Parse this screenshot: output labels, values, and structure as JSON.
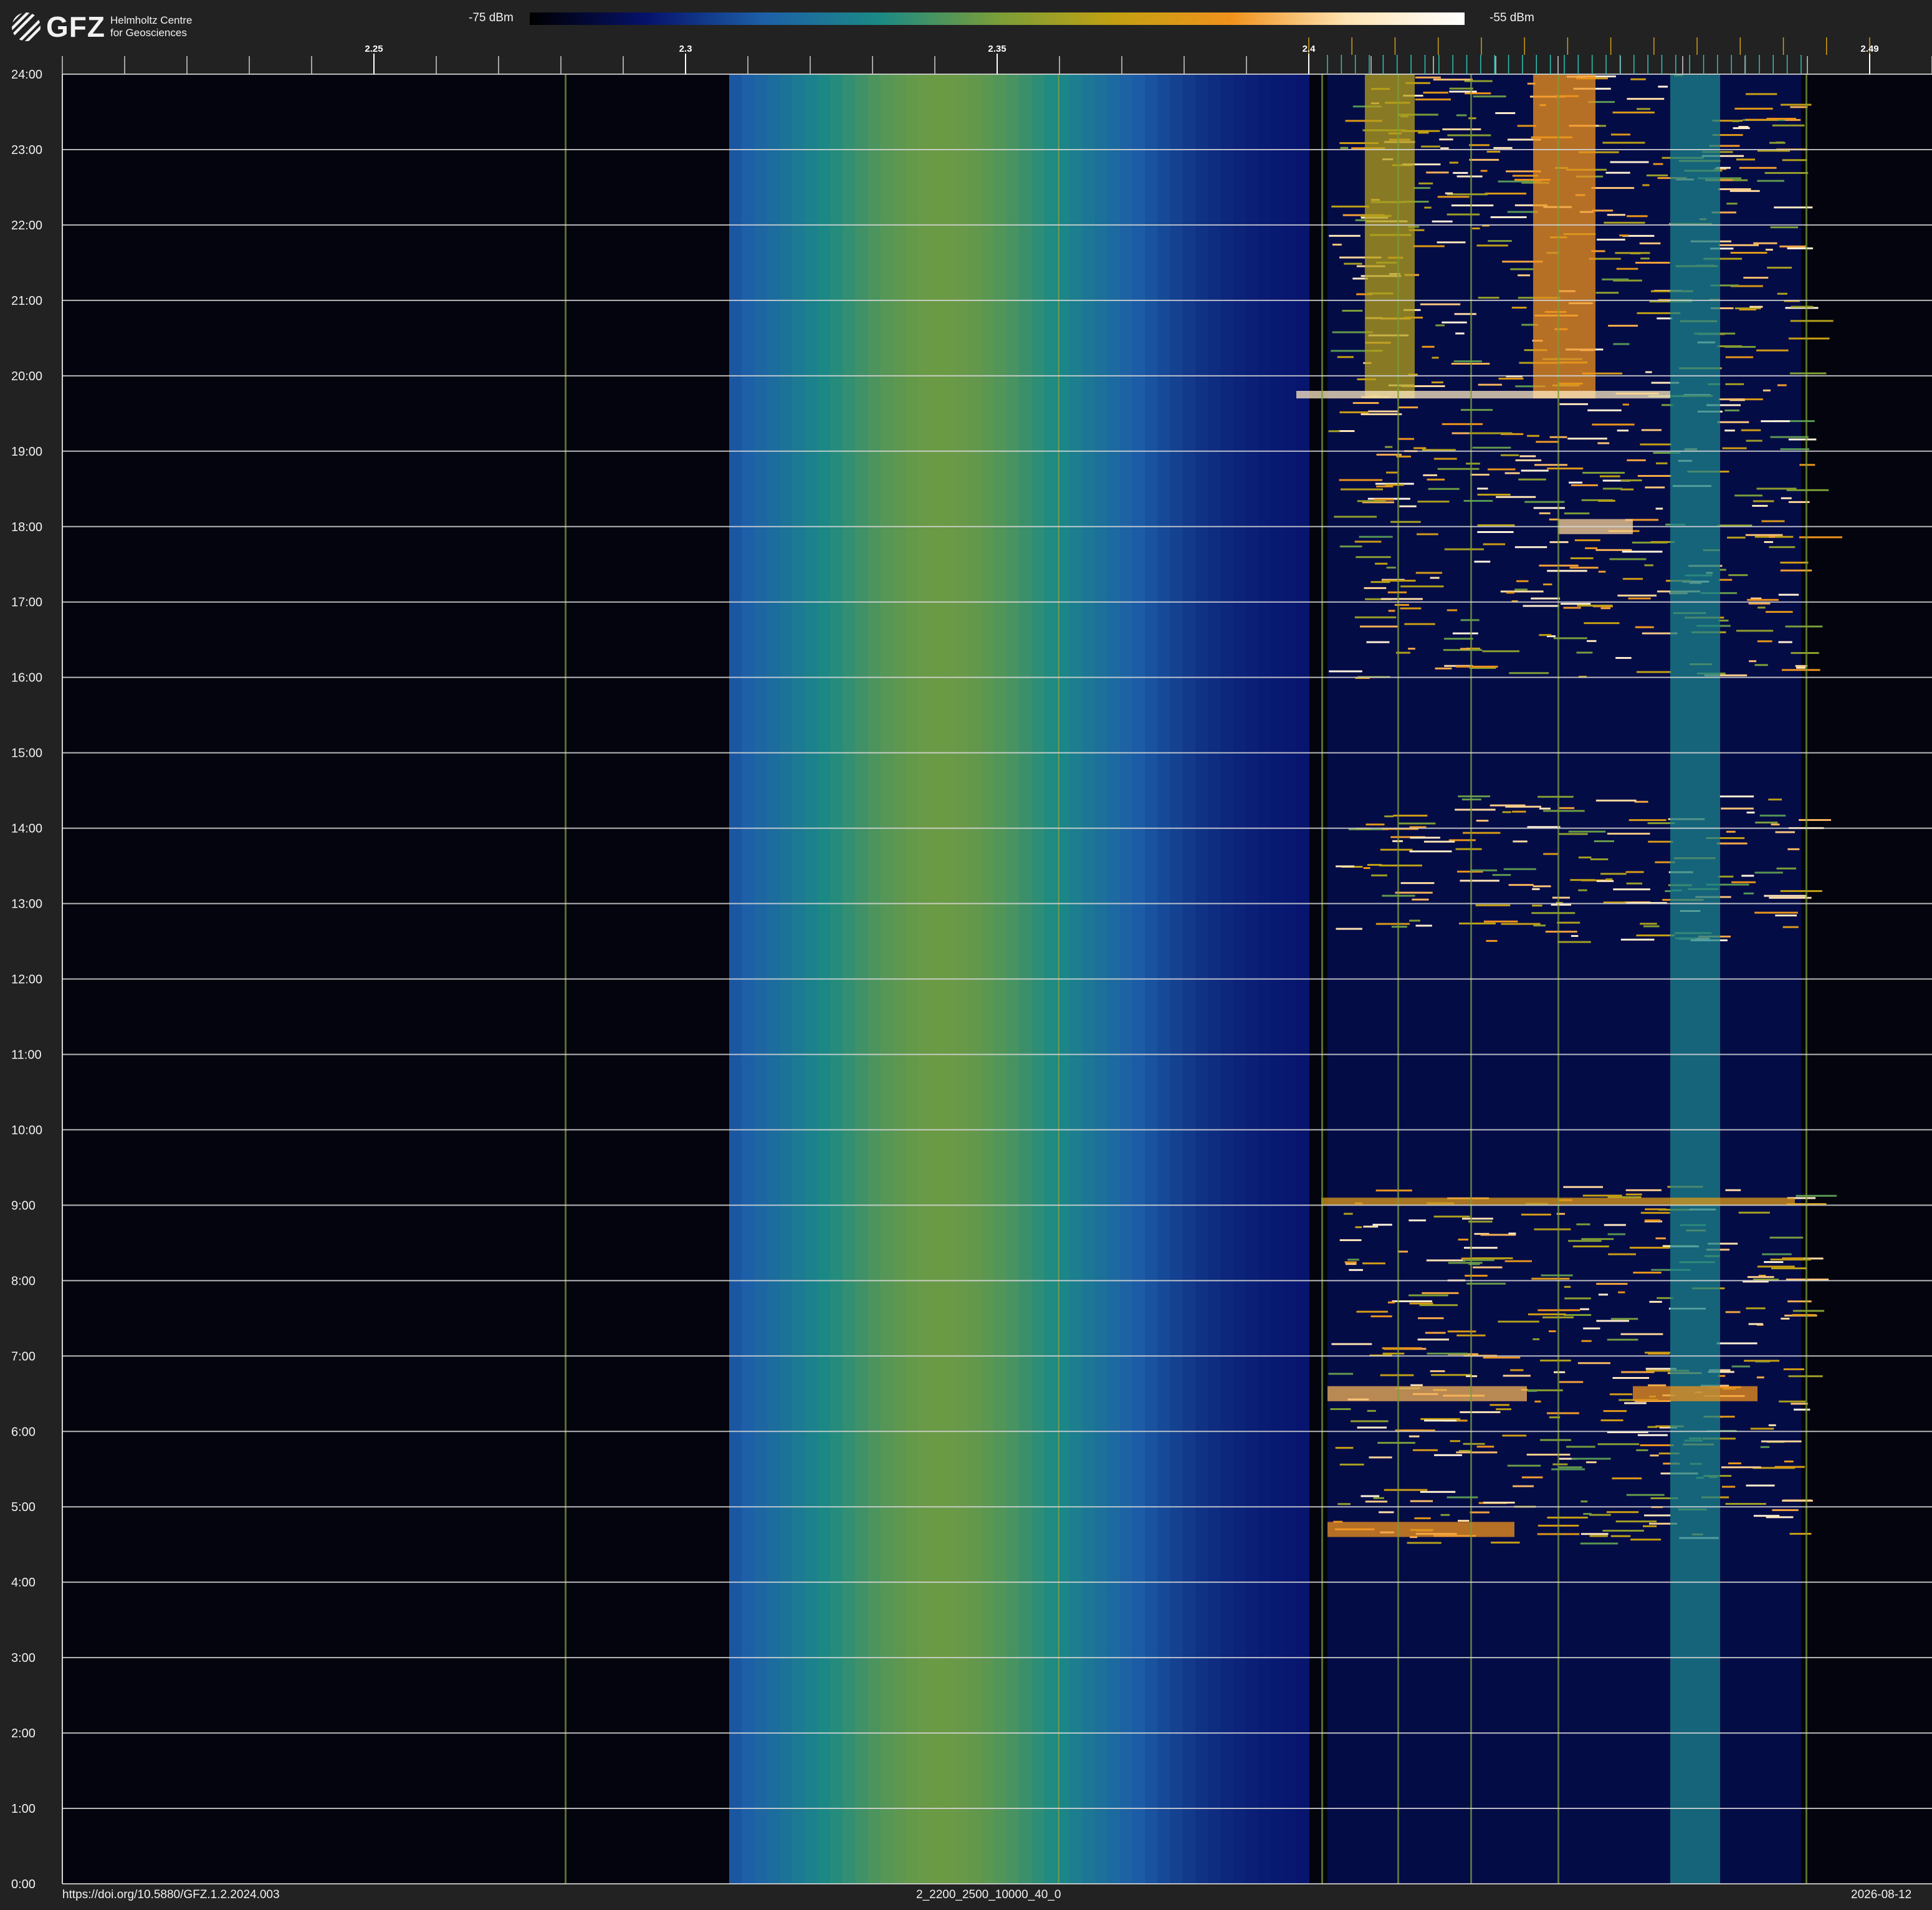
{
  "header": {
    "logo_wordmark": "GFZ",
    "logo_line1": "Helmholtz Centre",
    "logo_line2": "for Geosciences",
    "colorbar_min_label": "-75 dBm",
    "colorbar_max_label": "-55 dBm"
  },
  "footer": {
    "doi": "https://doi.org/10.5880/GFZ.1.2.2024.003",
    "dataset_code": "2_2200_2500_10000_40_0",
    "date": "2026-08-12"
  },
  "chart_data": {
    "type": "heatmap",
    "title": "",
    "xlabel": "",
    "ylabel": "",
    "x_unit": "GHz",
    "xlim": [
      2.2,
      2.5
    ],
    "x_tick_labels": [
      "2.25",
      "2.3",
      "2.35",
      "2.4",
      "2.49"
    ],
    "x_tick_values": [
      2.25,
      2.3,
      2.35,
      2.4,
      2.49
    ],
    "x_minor_tick_step": 0.01,
    "y_unit": "hour",
    "ylim": [
      0,
      24
    ],
    "y_tick_labels": [
      "0:00",
      "1:00",
      "2:00",
      "3:00",
      "4:00",
      "5:00",
      "6:00",
      "7:00",
      "8:00",
      "9:00",
      "10:00",
      "11:00",
      "12:00",
      "13:00",
      "14:00",
      "15:00",
      "16:00",
      "17:00",
      "18:00",
      "19:00",
      "20:00",
      "21:00",
      "22:00",
      "23:00",
      "24:00"
    ],
    "grid": "horizontal-hourly",
    "colorbar": {
      "min_dbm": -75,
      "max_dbm": -55,
      "stops": [
        "#000000",
        "#06126b",
        "#1d5fa8",
        "#1b8a84",
        "#7a9d39",
        "#c2a012",
        "#f0921c",
        "#ffe4b4",
        "#ffffff"
      ]
    },
    "background_color": "#03040d",
    "noise_band": {
      "x_range_ghz": [
        2.307,
        2.4
      ],
      "peak_ghz": 2.34,
      "peak_level": 0.36
    },
    "persistent_channels_ghz": [
      2.2807,
      2.3598,
      2.4021,
      2.4143,
      2.426,
      2.44,
      2.4798
    ],
    "wifi_band_ghz": [
      2.403,
      2.479
    ],
    "activity_clusters": [
      {
        "x_center_ghz": 2.413,
        "x_half_width_ghz": 0.004,
        "t_from": 19.7,
        "t_to": 24.0,
        "level": 0.6
      },
      {
        "x_center_ghz": 2.441,
        "x_half_width_ghz": 0.005,
        "t_from": 19.7,
        "t_to": 24.0,
        "level": 0.75
      },
      {
        "x_center_ghz": 2.462,
        "x_half_width_ghz": 0.004,
        "t_from": 0.0,
        "t_to": 24.0,
        "level": 0.35
      },
      {
        "x_center_ghz": 2.446,
        "x_half_width_ghz": 0.006,
        "t_from": 17.9,
        "t_to": 18.1,
        "level": 0.85
      },
      {
        "x_center_ghz": 2.428,
        "x_half_width_ghz": 0.03,
        "t_from": 19.7,
        "t_to": 19.8,
        "level": 0.9
      },
      {
        "x_center_ghz": 2.419,
        "x_half_width_ghz": 0.016,
        "t_from": 6.4,
        "t_to": 6.6,
        "level": 0.8
      },
      {
        "x_center_ghz": 2.462,
        "x_half_width_ghz": 0.01,
        "t_from": 6.4,
        "t_to": 6.6,
        "level": 0.75
      },
      {
        "x_center_ghz": 2.418,
        "x_half_width_ghz": 0.015,
        "t_from": 4.6,
        "t_to": 4.8,
        "level": 0.75
      },
      {
        "x_center_ghz": 2.44,
        "x_half_width_ghz": 0.038,
        "t_from": 9.0,
        "t_to": 9.1,
        "level": 0.7
      }
    ],
    "wifi_activity_windows_hours": [
      [
        4.5,
        9.3
      ],
      [
        12.5,
        14.5
      ],
      [
        16.0,
        17.5
      ],
      [
        17.5,
        24.0
      ]
    ]
  }
}
